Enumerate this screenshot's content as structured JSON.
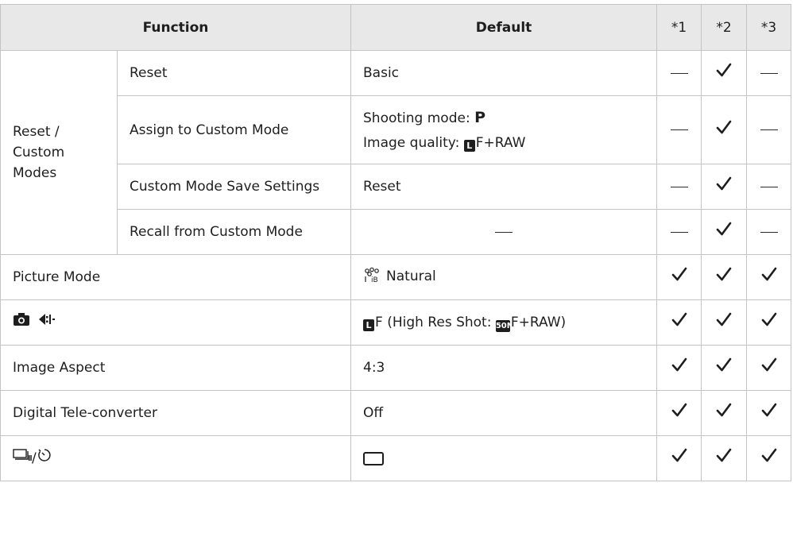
{
  "headers": {
    "function": "Function",
    "default": "Default",
    "c1": "*1",
    "c2": "*2",
    "c3": "*3"
  },
  "group_label": "Reset / Custom Modes",
  "rows": [
    {
      "sub": "Reset",
      "default": "Basic",
      "marks": [
        "—",
        "✓",
        "—"
      ]
    },
    {
      "sub": "Assign to Custom Mode",
      "default_line1_prefix": "Shooting mode: ",
      "default_line1_mode": "P",
      "default_line2_prefix": "Image quality: ",
      "default_line2_icon": "L",
      "default_line2_suffix": "F+RAW",
      "marks": [
        "—",
        "✓",
        "—"
      ]
    },
    {
      "sub": "Custom Mode Save Settings",
      "default": "Reset",
      "marks": [
        "—",
        "✓",
        "—"
      ]
    },
    {
      "sub": "Recall from Custom Mode",
      "default": "—",
      "marks": [
        "—",
        "✓",
        "—"
      ]
    },
    {
      "function": "Picture Mode",
      "default_icon": "picture-mode-natural-icon",
      "default": "Natural",
      "marks": [
        "✓",
        "✓",
        "✓"
      ]
    },
    {
      "function_icons": [
        "camera-icon",
        "image-quality-icon"
      ],
      "default_icon": "L",
      "default": "F (High Res Shot: ",
      "default_icon2": "50M",
      "default_suffix": "F+RAW)",
      "marks": [
        "✓",
        "✓",
        "✓"
      ]
    },
    {
      "function": "Image Aspect",
      "default": "4:3",
      "marks": [
        "✓",
        "✓",
        "✓"
      ]
    },
    {
      "function": "Digital Tele-converter",
      "default": "Off",
      "marks": [
        "✓",
        "✓",
        "✓"
      ]
    },
    {
      "function_icons": [
        "sequential-shooting-icon",
        "self-timer-icon"
      ],
      "function_sep": "/",
      "default_icon": "single-frame-icon",
      "marks": [
        "✓",
        "✓",
        "✓"
      ]
    }
  ]
}
